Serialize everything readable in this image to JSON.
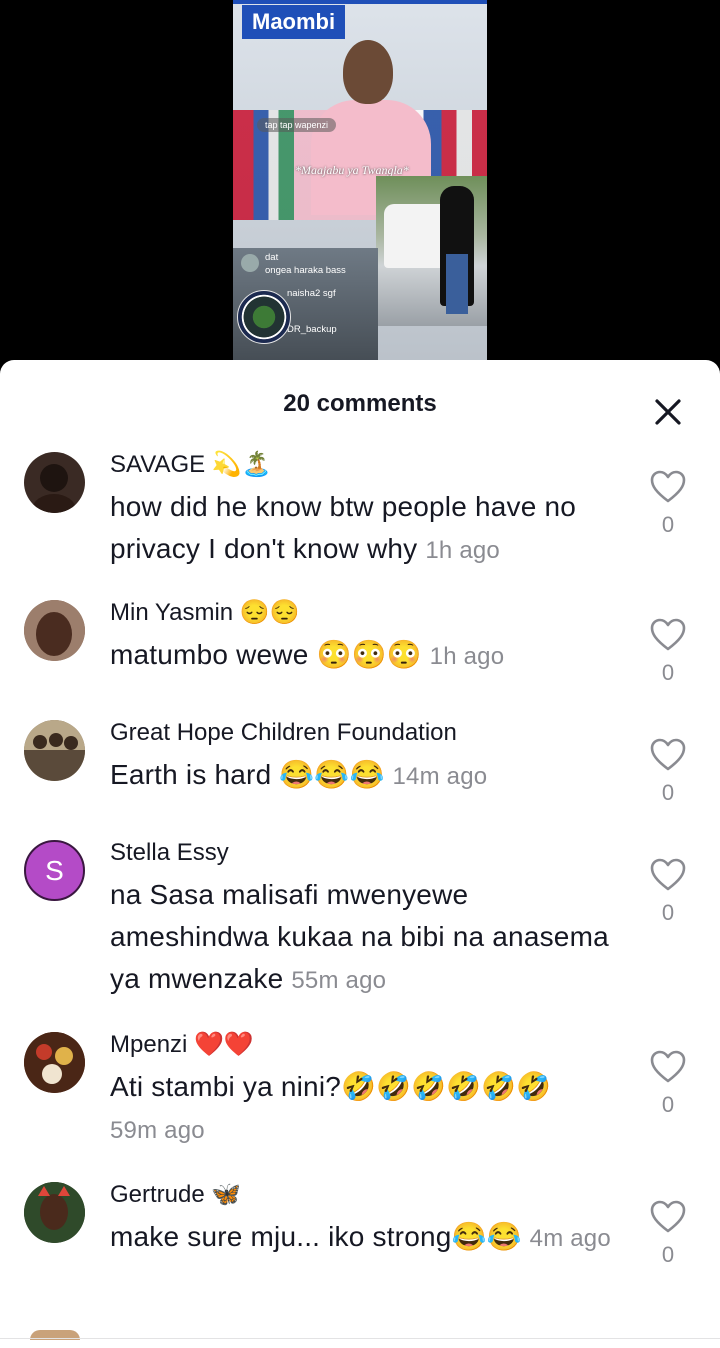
{
  "video": {
    "title": "Maombi",
    "pill_text": "tap tap wapenzi",
    "caption": "*Maajabu ya Twangla*",
    "live_comments": [
      {
        "user": "dat",
        "text": "ongea haraka bass"
      },
      {
        "user": "naisha2 sgf",
        "text": ""
      },
      {
        "user": "DR_backup",
        "text": ""
      }
    ]
  },
  "sheet": {
    "title": "20 comments",
    "close_icon": "close-icon"
  },
  "comments": [
    {
      "name": "SAVAGE 💫🏝️",
      "text": "how did he know btw people have no privacy I don't know why",
      "time": "1h ago",
      "likes": "0",
      "avatar_color": "#3a2a24"
    },
    {
      "name": "Min Yasmin 😔😔",
      "text": "matumbo wewe 😳😳😳",
      "time": "1h ago",
      "likes": "0",
      "avatar_color": "#5a3b2e"
    },
    {
      "name": "Great Hope Children Foundation",
      "text": "Earth is hard 😂😂😂",
      "time": "14m ago",
      "likes": "0",
      "avatar_color": "#7d6a55"
    },
    {
      "name": "Stella Essy",
      "text": "na Sasa malisafi mwenyewe ameshindwa kukaa na bibi na anasema ya mwenzake",
      "time": "55m ago",
      "likes": "0",
      "avatar_letter": "S",
      "avatar_color": "#b44bc7"
    },
    {
      "name": "Mpenzi ❤️❤️",
      "text": "Ati stambi ya nini?🤣🤣🤣🤣🤣🤣",
      "time": "59m ago",
      "likes": "0",
      "avatar_color": "#6b3a22"
    },
    {
      "name": "Gertrude 🦋",
      "text": "make sure mju... iko strong😂😂",
      "time": "4m ago",
      "likes": "0",
      "avatar_color": "#2e3a2a"
    }
  ]
}
